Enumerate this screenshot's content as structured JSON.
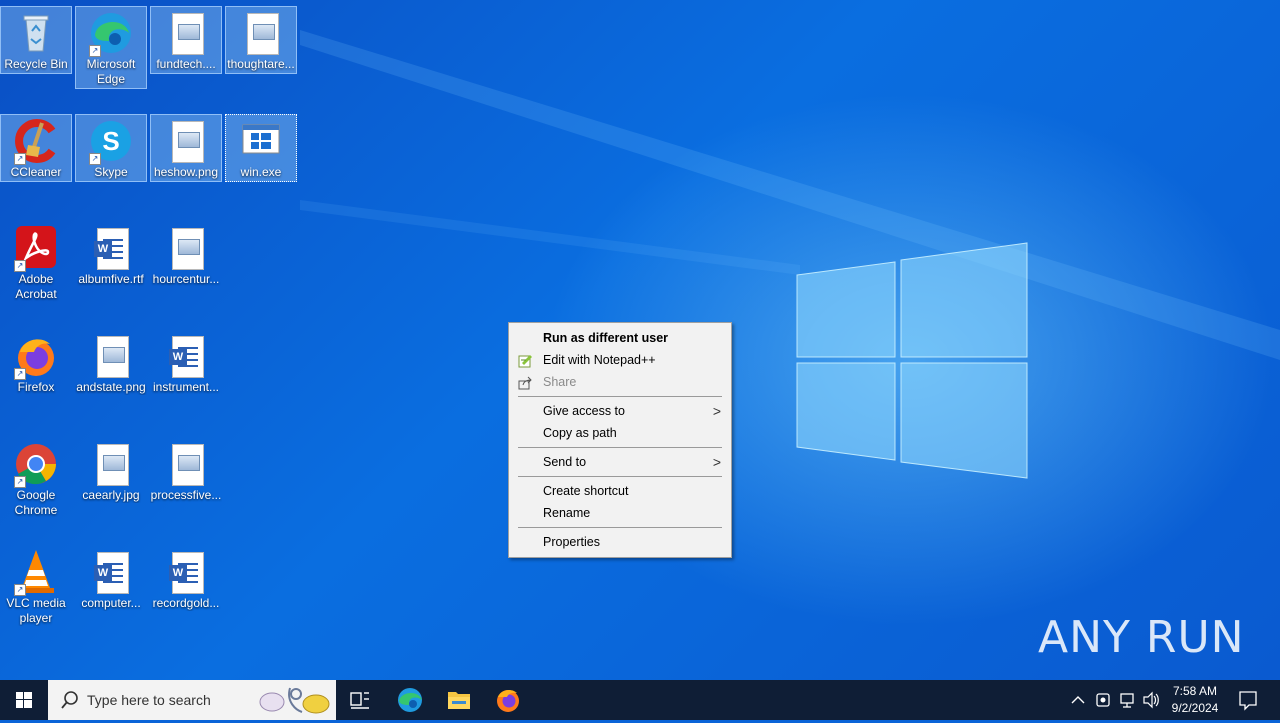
{
  "desktop": {
    "icons": [
      {
        "label": "Recycle Bin"
      },
      {
        "label": "Microsoft Edge"
      },
      {
        "label": "fundtech...."
      },
      {
        "label": "thoughtare..."
      },
      {
        "label": "CCleaner"
      },
      {
        "label": "Skype"
      },
      {
        "label": "heshow.png"
      },
      {
        "label": "win.exe"
      },
      {
        "label": "Adobe Acrobat"
      },
      {
        "label": "albumfive.rtf"
      },
      {
        "label": "hourcentur..."
      },
      {
        "label": "Firefox"
      },
      {
        "label": "andstate.png"
      },
      {
        "label": "instrument..."
      },
      {
        "label": "Google Chrome"
      },
      {
        "label": "caearly.jpg"
      },
      {
        "label": "processfive..."
      },
      {
        "label": "VLC media player"
      },
      {
        "label": "computer..."
      },
      {
        "label": "recordgold..."
      }
    ]
  },
  "context_menu": {
    "items": [
      {
        "label": "Run as different user"
      },
      {
        "label": "Edit with Notepad++"
      },
      {
        "label": "Share"
      },
      {
        "label": "Give access to"
      },
      {
        "label": "Copy as path"
      },
      {
        "label": "Send to"
      },
      {
        "label": "Create shortcut"
      },
      {
        "label": "Rename"
      },
      {
        "label": "Properties"
      }
    ]
  },
  "taskbar": {
    "search_placeholder": "Type here to search",
    "clock_time": "7:58 AM",
    "clock_date": "9/2/2024"
  },
  "watermark": "ANY RUN",
  "colors": {
    "taskbar": "#0f1e36",
    "menu_bg": "#f2f2f2",
    "desktop_blue": "#0a64d8"
  }
}
